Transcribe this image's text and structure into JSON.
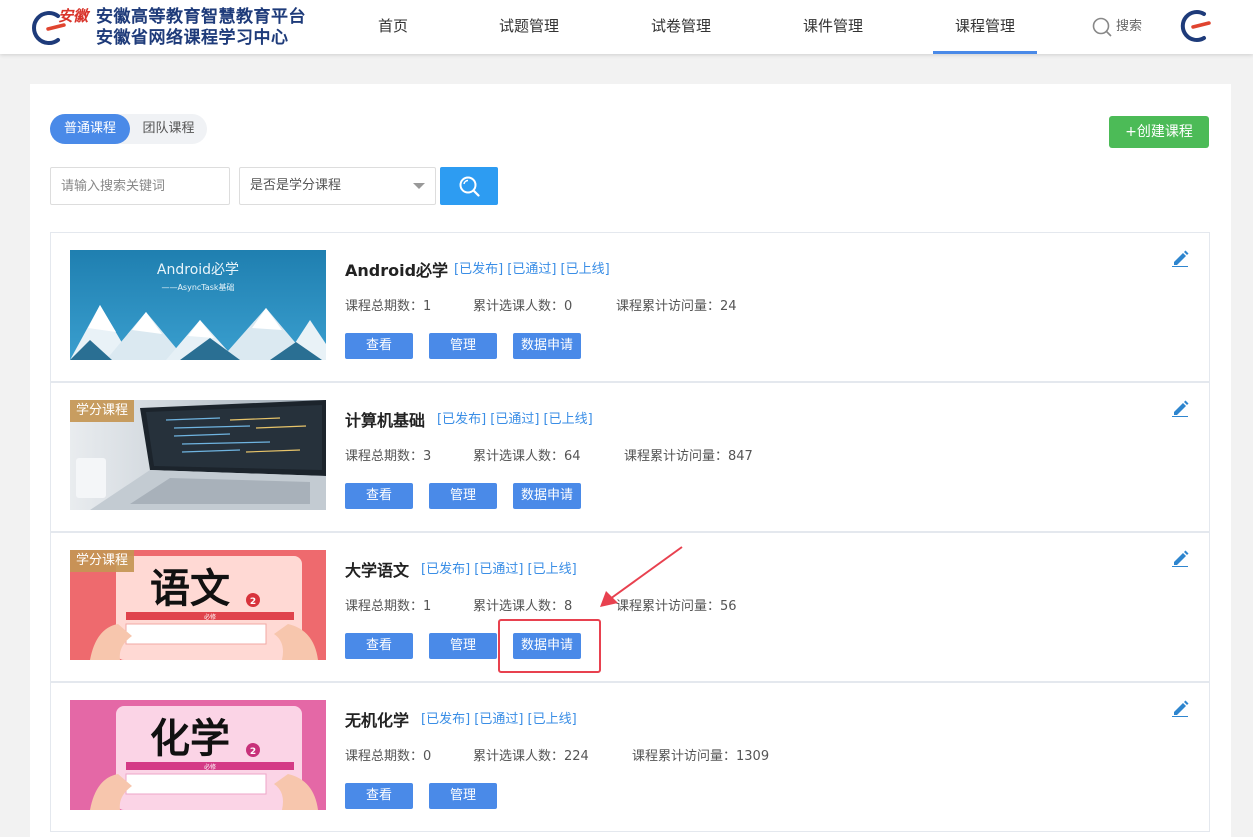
{
  "header": {
    "logo_seal": "安徽",
    "logo_line1": "安徽高等教育智慧教育平台",
    "logo_line2": "安徽省网络课程学习中心",
    "nav": [
      {
        "label": "首页"
      },
      {
        "label": "试题管理"
      },
      {
        "label": "试卷管理"
      },
      {
        "label": "课件管理"
      },
      {
        "label": "课程管理",
        "active": true
      }
    ],
    "search_label": "搜索"
  },
  "toolbar": {
    "tabs": [
      "普通课程",
      "团队课程"
    ],
    "create_label": "+创建课程",
    "search_placeholder": "请输入搜索关键词",
    "credit_filter": "是否是学分课程"
  },
  "courses": [
    {
      "title": "Android必学",
      "status": "[已发布] [已通过] [已上线]",
      "periods_label": "课程总期数：1",
      "students_label": "累计选课人数：0",
      "visits_label": "课程累计访问量：24",
      "credit_tag": "",
      "thumb_line1": "Android必学",
      "thumb_line2": "——AsyncTask基础",
      "buttons": [
        "查看",
        "管理",
        "数据申请"
      ]
    },
    {
      "title": "计算机基础",
      "status": "[已发布] [已通过] [已上线]",
      "periods_label": "课程总期数：3",
      "students_label": "累计选课人数：64",
      "visits_label": "课程累计访问量：847",
      "credit_tag": "学分课程",
      "buttons": [
        "查看",
        "管理",
        "数据申请"
      ]
    },
    {
      "title": "大学语文",
      "status": "[已发布] [已通过] [已上线]",
      "periods_label": "课程总期数：1",
      "students_label": "累计选课人数：8",
      "visits_label": "课程累计访问量：56",
      "credit_tag": "学分课程",
      "thumb_big": "语文",
      "thumb_small": "必修",
      "thumb_num": "2",
      "buttons": [
        "查看",
        "管理",
        "数据申请"
      ]
    },
    {
      "title": "无机化学",
      "status": "[已发布] [已通过] [已上线]",
      "periods_label": "课程总期数：0",
      "students_label": "累计选课人数：224",
      "visits_label": "课程累计访问量：1309",
      "credit_tag": "",
      "thumb_big": "化学",
      "thumb_small": "必修",
      "thumb_num": "2",
      "buttons": [
        "查看",
        "管理"
      ]
    }
  ],
  "colors": {
    "primary": "#4a8ae8",
    "create": "#4cbb57",
    "status": "#3a8ee6",
    "highlight": "#e8414f"
  }
}
